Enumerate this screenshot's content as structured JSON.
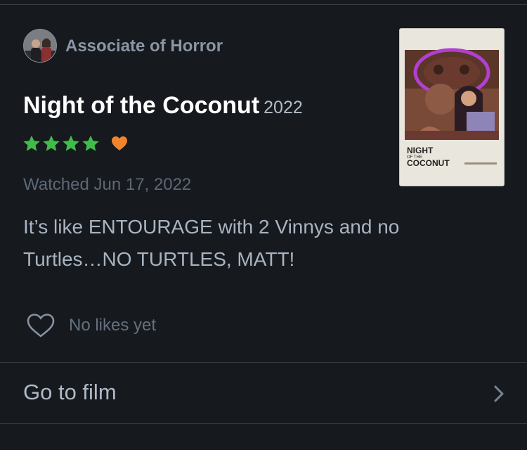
{
  "review": {
    "author": "Associate of Horror",
    "film_title": "Night of the Coconut",
    "film_year": "2022",
    "rating_stars": 4,
    "liked": true,
    "watched_text": "Watched Jun 17, 2022",
    "text": "It’s like ENTOURAGE with 2 Vinnys and no Turtles…NO TURTLES, MATT!",
    "likes_text": "No likes yet"
  },
  "poster": {
    "title_line1": "NIGHT",
    "title_line2": "OF THE",
    "title_line3": "COCONUT"
  },
  "actions": {
    "go_to_film": "Go to film"
  },
  "colors": {
    "background": "#16191e",
    "star": "#40bc4a",
    "liked_heart": "#f0852d",
    "poster_art": "#8a4a3a"
  }
}
